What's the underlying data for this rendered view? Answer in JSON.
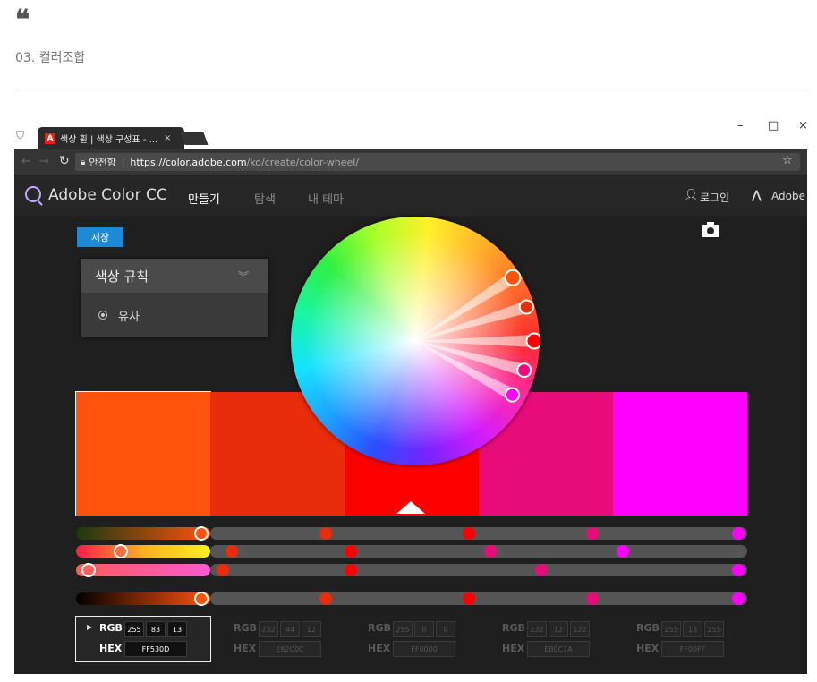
{
  "article": {
    "quote_glyph": "❝",
    "caption": "03. 컬러조합"
  },
  "browser": {
    "tab_title": "색상 휠 | 색상 구성표 - ...",
    "tab_close": "×",
    "window_buttons": [
      "–",
      "□",
      "×"
    ],
    "secure_label": "안전함",
    "separator": "|",
    "url_host": "https://color.adobe.com",
    "url_path": "/ko/create/color-wheel/",
    "icons": [
      "incognito-icon",
      "back-arrow-icon",
      "forward-arrow-icon",
      "reload-icon",
      "lock-icon",
      "star-icon"
    ]
  },
  "app": {
    "brand": "Adobe Color CC",
    "nav": [
      "만들기",
      "탐색",
      "내 테마"
    ],
    "login": "로그인",
    "adobe": "Adobe",
    "save_label": "저장",
    "rule_title": "색상 규칙",
    "rule_option": "유사"
  },
  "palette": {
    "swatches": [
      {
        "hex": "#FF530D",
        "selected": true
      },
      {
        "hex": "#E82C0C",
        "selected": false
      },
      {
        "hex": "#FF0000",
        "selected": false,
        "base": true
      },
      {
        "hex": "#E80C7A",
        "selected": false
      },
      {
        "hex": "#FF00FF",
        "selected": false
      }
    ],
    "values": [
      {
        "rgb_label": "RGB",
        "hex_label": "HEX",
        "r": "255",
        "g": "83",
        "b": "13",
        "hex": "FF530D",
        "active": true
      },
      {
        "rgb_label": "RGB",
        "hex_label": "HEX",
        "r": "232",
        "g": "44",
        "b": "12",
        "hex": "E82C0C",
        "active": false
      },
      {
        "rgb_label": "RGB",
        "hex_label": "HEX",
        "r": "255",
        "g": "0",
        "b": "0",
        "hex": "FF0000",
        "active": false
      },
      {
        "rgb_label": "RGB",
        "hex_label": "HEX",
        "r": "232",
        "g": "12",
        "b": "122",
        "hex": "E80C7A",
        "active": false
      },
      {
        "rgb_label": "RGB",
        "hex_label": "HEX",
        "r": "255",
        "g": "13",
        "b": "255",
        "hex": "FF00FF",
        "active": false
      }
    ]
  }
}
